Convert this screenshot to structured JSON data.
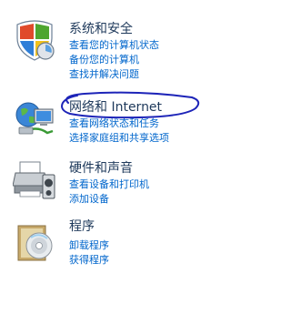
{
  "categories": [
    {
      "icon": "security-shield-icon",
      "title": "系统和安全",
      "links": [
        "查看您的计算机状态",
        "备份您的计算机",
        "查找并解决问题"
      ]
    },
    {
      "icon": "network-globe-icon",
      "title": "网络和 Internet",
      "links": [
        "查看网络状态和任务",
        "选择家庭组和共享选项"
      ]
    },
    {
      "icon": "printer-speaker-icon",
      "title": "硬件和声音",
      "links": [
        "查看设备和打印机",
        "添加设备"
      ]
    },
    {
      "icon": "programs-disc-icon",
      "title": "程序",
      "links": [
        "卸载程序",
        "获得程序"
      ]
    }
  ],
  "colors": {
    "title": "#1e395b",
    "link": "#0066cc",
    "annotation": "#1d24b8"
  }
}
